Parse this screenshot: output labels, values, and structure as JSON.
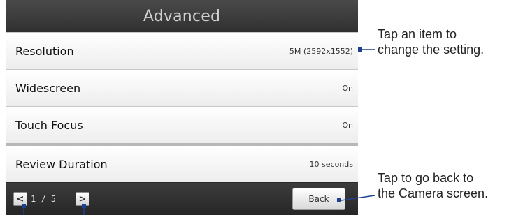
{
  "screen": {
    "title": "Advanced"
  },
  "settings": [
    {
      "label": "Resolution",
      "value": "5M (2592x1552)"
    },
    {
      "label": "Widescreen",
      "value": "On"
    },
    {
      "label": "Touch Focus",
      "value": "On"
    },
    {
      "label": "Review Duration",
      "value": "10 seconds"
    }
  ],
  "pager": {
    "prev_icon": "chevron-left-icon",
    "next_icon": "chevron-right-icon",
    "indicator": "1 / 5"
  },
  "buttons": {
    "back_label": "Back"
  },
  "callouts": {
    "items_line1": "Tap an item to",
    "items_line2": "change the setting.",
    "back_line1": "Tap to go back to",
    "back_line2": "the Camera screen."
  },
  "colors": {
    "title_bar": "#3a3a3a",
    "row_background": "#f4f4f4",
    "bottom_bar": "#2e2e2e",
    "callout_line": "#1f3f8f"
  }
}
